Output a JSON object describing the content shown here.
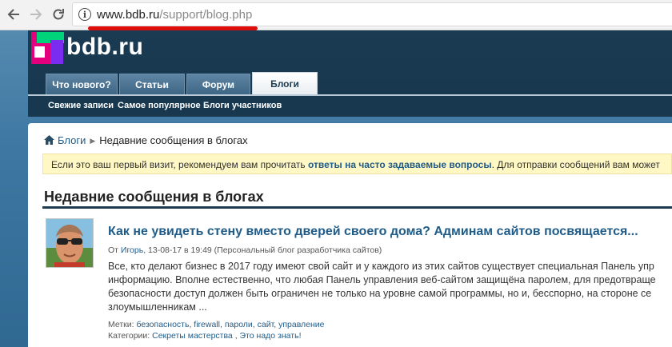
{
  "browser": {
    "url_host": "www.bdb.ru",
    "url_path": "/support/blog.php",
    "info_icon_glyph": "i"
  },
  "site": {
    "logo_text": "bdb.ru",
    "colors": {
      "header_bg": "#17384f",
      "link": "#1f5c8a",
      "logo_pink": "#e4007c",
      "logo_green": "#00d37a",
      "logo_purple": "#7a2cf0"
    }
  },
  "tabs": [
    {
      "label": "Что нового?",
      "active": false
    },
    {
      "label": "Статьи",
      "active": false
    },
    {
      "label": "Форум",
      "active": false
    },
    {
      "label": "Блоги",
      "active": true
    }
  ],
  "subnav": [
    {
      "label": "Свежие записи"
    },
    {
      "label": "Самое популярное"
    },
    {
      "label": "Блоги участников"
    }
  ],
  "breadcrumb": {
    "home_icon": "home-icon",
    "root": "Блоги",
    "current": "Недавние сообщения в блогах"
  },
  "notice": {
    "before": "Если это ваш первый визит, рекомендуем вам прочитать ",
    "link": "ответы на часто задаваемые вопросы",
    "after": ". Для отправки сообщений вам может"
  },
  "section_title": "Недавние сообщения в блогах",
  "post": {
    "title": "Как не увидеть стену вместо дверей своего дома? Админам сайтов посвящается...",
    "meta_prefix": "От ",
    "author": "Игорь",
    "meta_rest": ", 13-08-17 в 19:49 (Персональный блог разработчика сайтов)",
    "body_lines": [
      "Все, кто делают бизнес в 2017 году имеют свой сайт и у каждого из этих сайтов существует специальная Панель упр",
      "информацию. Вполне естественно, что любая Панель управления веб-сайтом защищёна паролем, для предотвраще",
      "безопасности доступ должен быть ограничен не только на уровне самой программы, но и, бесспорно, на стороне се",
      "злоумышленникам ..."
    ],
    "tags_label": "Метки: ",
    "tags": [
      "безопасность",
      "firewall",
      "пароли",
      "сайт",
      "управление"
    ],
    "cats_label": "Категории: ",
    "categories": [
      "Секреты мастерства",
      "Это надо знать!"
    ]
  }
}
